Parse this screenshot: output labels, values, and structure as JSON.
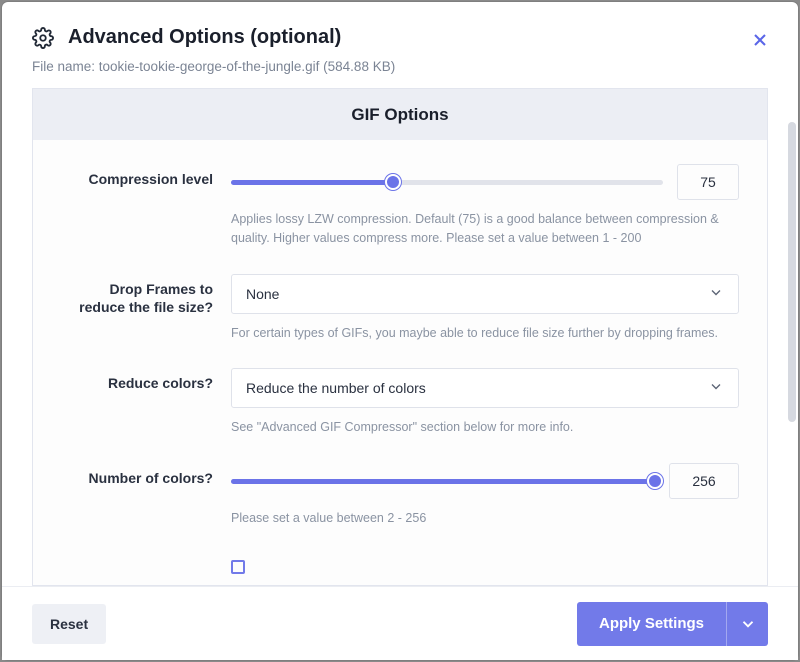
{
  "header": {
    "title": "Advanced Options (optional)"
  },
  "file": {
    "label": "File name: ",
    "value": "tookie-tookie-george-of-the-jungle.gif (584.88 KB)"
  },
  "section": {
    "title": "GIF Options"
  },
  "compression": {
    "label": "Compression level",
    "value": "75",
    "pct": 37.5,
    "help": "Applies lossy LZW compression. Default (75) is a good balance between compression & quality. Higher values compress more. Please set a value between 1 - 200"
  },
  "dropframes": {
    "label": "Drop Frames to reduce the file size?",
    "value": "None",
    "help": "For certain types of GIFs, you maybe able to reduce file size further by dropping frames."
  },
  "reducecolors": {
    "label": "Reduce colors?",
    "value": "Reduce the number of colors",
    "help": "See \"Advanced GIF Compressor\" section below for more info."
  },
  "numcolors": {
    "label": "Number of colors?",
    "value": "256",
    "pct": 100,
    "help": "Please set a value between 2 - 256"
  },
  "footer": {
    "reset": "Reset",
    "apply": "Apply Settings"
  }
}
